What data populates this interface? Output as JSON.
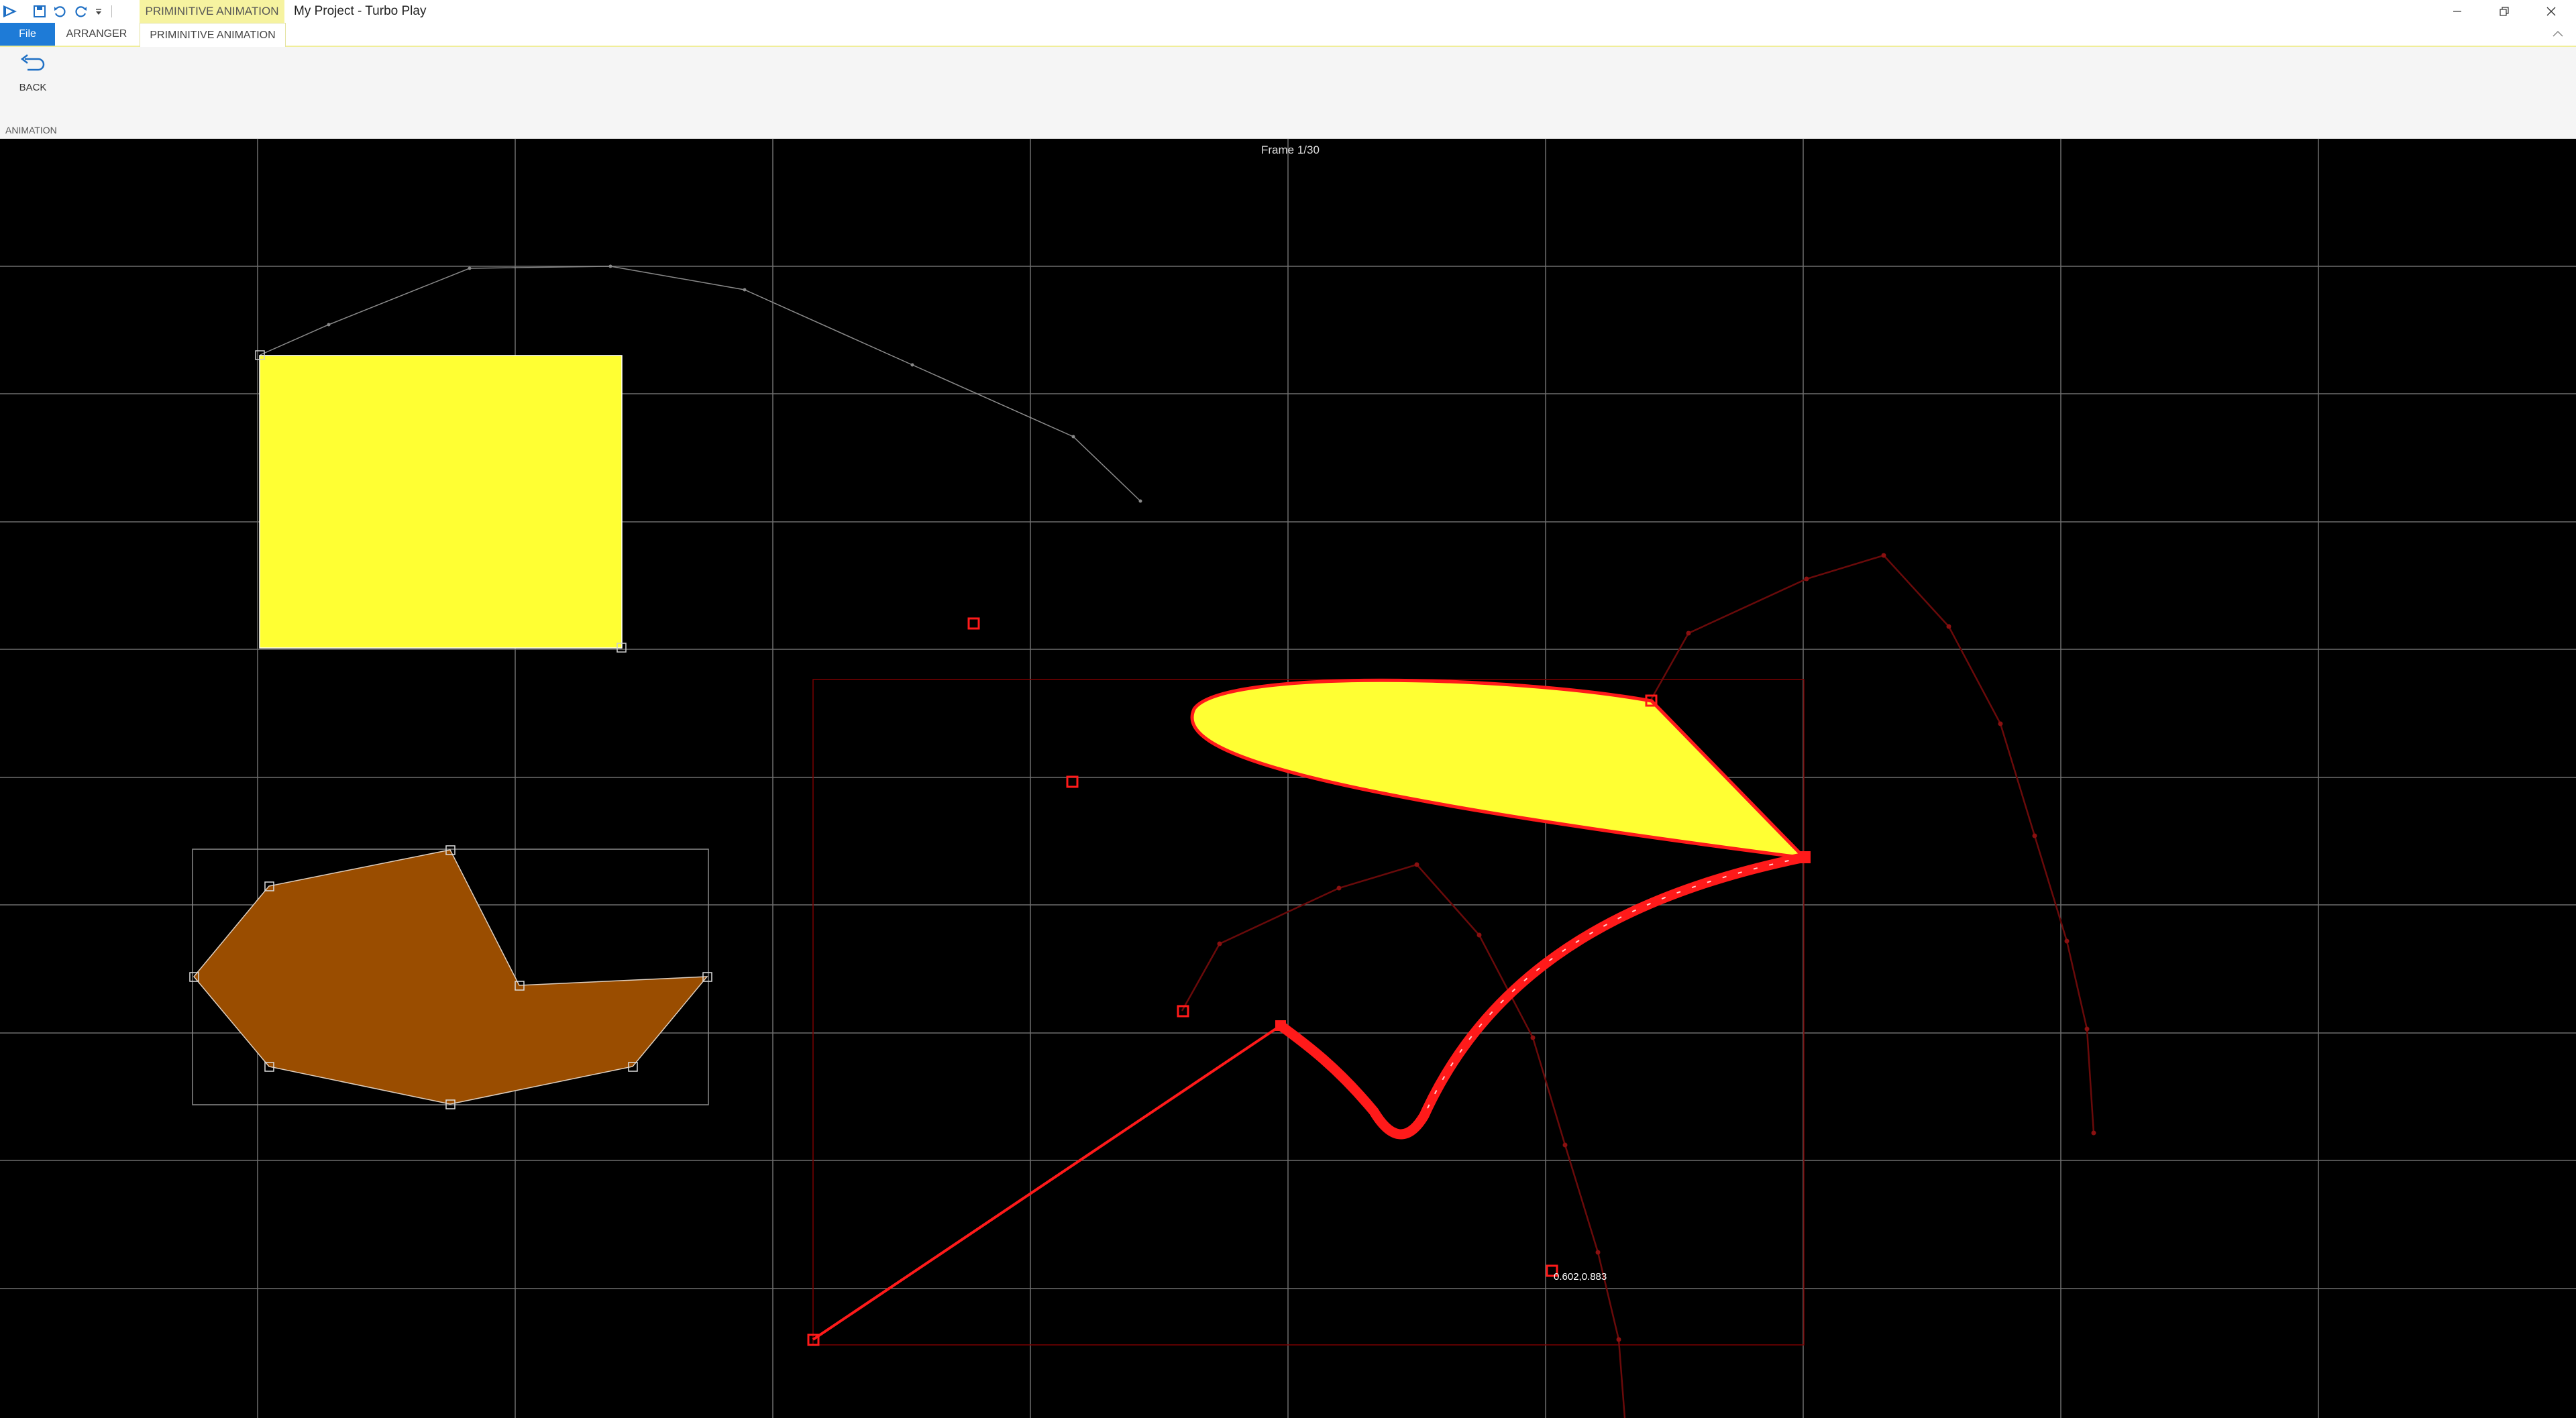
{
  "titlebar": {
    "context_tab": "PRIMINITIVE ANIMATION",
    "title": "My Project - Turbo Play",
    "quick_access": [
      "app-logo-icon",
      "save-icon",
      "undo-icon",
      "redo-icon",
      "customize-dropdown-icon"
    ],
    "window_buttons": [
      "minimize-icon",
      "restore-icon",
      "close-icon"
    ]
  },
  "tabs": {
    "file": "File",
    "arranger": "ARRANGER",
    "primitive_animation": "PRIMINITIVE ANIMATION"
  },
  "ribbon": {
    "back_label": "BACK",
    "group_label": "ANIMATION"
  },
  "canvas": {
    "frame_label": "Frame 1/30",
    "coord_readout": "0.602,0.883"
  },
  "colors": {
    "accent_file_tab": "#1e7bd7",
    "context_band": "#f6f3a0",
    "canvas_bg": "#000000",
    "grid": "#6e6e6e",
    "yellow_fill": "#ffff33",
    "brown_fill": "#9a4d00",
    "selection_red": "#ff1a1a"
  }
}
